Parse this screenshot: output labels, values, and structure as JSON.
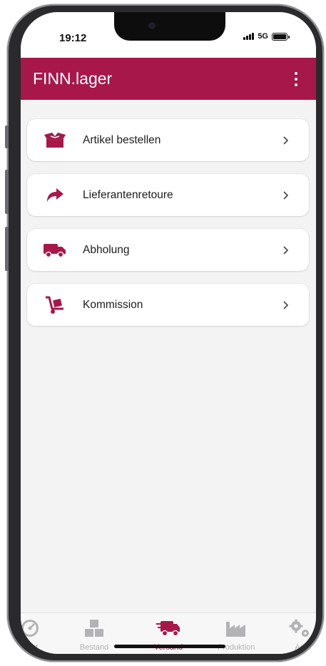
{
  "status_bar": {
    "time": "19:12",
    "network": "5G"
  },
  "app_bar": {
    "title": "FINN.lager",
    "menu_icon": "more-vert-icon"
  },
  "colors": {
    "brand": "#a8174a",
    "inactive": "#b3b3b6"
  },
  "menu_items": [
    {
      "label": "Artikel bestellen",
      "icon": "open-box-icon"
    },
    {
      "label": "Lieferantenretoure",
      "icon": "share-arrow-icon"
    },
    {
      "label": "Abholung",
      "icon": "truck-icon"
    },
    {
      "label": "Kommission",
      "icon": "hand-truck-icon"
    }
  ],
  "bottom_nav": [
    {
      "label": "oard",
      "icon": "dashboard-icon",
      "active": false
    },
    {
      "label": "Bestand",
      "icon": "boxes-icon",
      "active": false
    },
    {
      "label": "Versand",
      "icon": "shipping-fast-icon",
      "active": true
    },
    {
      "label": "Produktion",
      "icon": "factory-icon",
      "active": false
    },
    {
      "label": "Ad",
      "icon": "gears-icon",
      "active": false
    }
  ]
}
